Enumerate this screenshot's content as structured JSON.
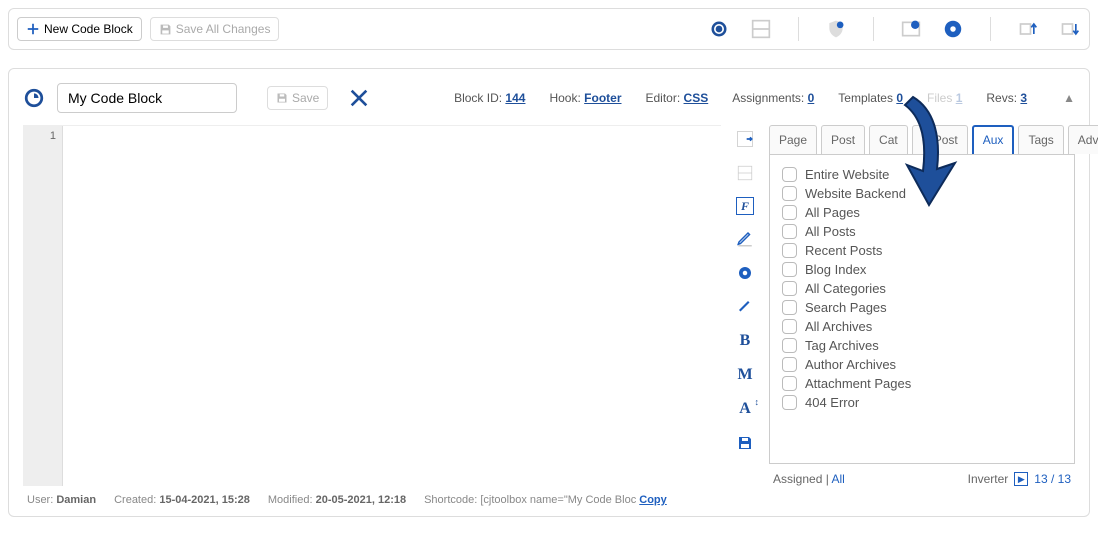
{
  "topbar": {
    "new_block_label": "New Code Block",
    "save_all_label": "Save All Changes"
  },
  "header": {
    "title_value": "My Code Block",
    "save_label": "Save",
    "meta": {
      "block_id_label": "Block ID:",
      "block_id_value": "144",
      "hook_label": "Hook:",
      "hook_value": "Footer",
      "editor_label": "Editor:",
      "editor_value": "CSS",
      "assignments_label": "Assignments:",
      "assignments_value": "0",
      "templates_label": "Templates",
      "templates_value": "0",
      "files_label": "Files",
      "files_value": "1",
      "revs_label": "Revs:",
      "revs_value": "3"
    }
  },
  "editor": {
    "line_number": "1"
  },
  "tabs": [
    {
      "label": "Page",
      "active": false
    },
    {
      "label": "Post",
      "active": false
    },
    {
      "label": "Cat",
      "active": false
    },
    {
      "label": "C.Post",
      "active": false
    },
    {
      "label": "Aux",
      "active": true
    },
    {
      "label": "Tags",
      "active": false
    },
    {
      "label": "Adv",
      "active": false
    }
  ],
  "aux_items": [
    "Entire Website",
    "Website Backend",
    "All Pages",
    "All Posts",
    "Recent Posts",
    "Blog Index",
    "All Categories",
    "Search Pages",
    "All Archives",
    "Tag Archives",
    "Author Archives",
    "Attachment Pages",
    "404 Error"
  ],
  "assign_footer": {
    "assigned_label": "Assigned",
    "all_label": "All",
    "inverter_label": "Inverter",
    "count": "13 / 13"
  },
  "footer": {
    "user_label": "User:",
    "user_value": "Damian",
    "created_label": "Created:",
    "created_value": "15-04-2021, 15:28",
    "modified_label": "Modified:",
    "modified_value": "20-05-2021, 12:18",
    "shortcode_label": "Shortcode:",
    "shortcode_value": "[cjtoolbox name=\"My Code Bloc",
    "copy_label": "Copy"
  }
}
